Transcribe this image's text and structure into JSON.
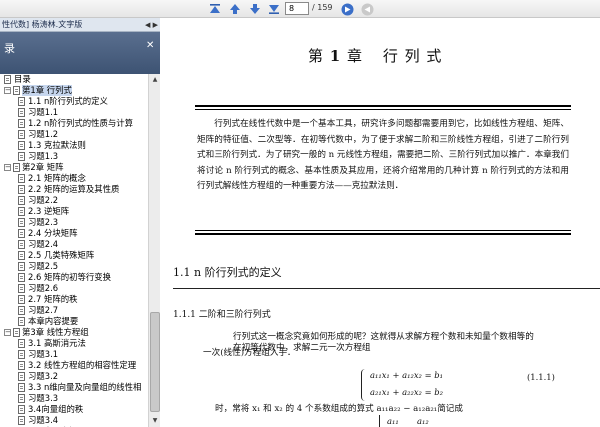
{
  "toolbar": {
    "icons": [
      "go-first-icon",
      "go-prev-icon",
      "go-next-icon",
      "go-last-icon",
      "go-forward-icon",
      "go-back-icon"
    ],
    "page_number": "8",
    "page_total": "/ 159"
  },
  "sidebar": {
    "doc_tab_label": "性代数] 杨涛林.文字版",
    "doc_tab_arrows": "◀ ▶",
    "bookmarks_title": "录",
    "close_glyph": "✕",
    "items": [
      {
        "label": "目录",
        "level": 0,
        "expand": ""
      },
      {
        "label": "第1章  行列式",
        "level": 0,
        "expand": "−",
        "selected": true
      },
      {
        "label": "1.1  n阶行列式的定义",
        "level": 1,
        "expand": ""
      },
      {
        "label": "习题1.1",
        "level": 1,
        "expand": ""
      },
      {
        "label": "1.2  n阶行列式的性质与计算",
        "level": 1,
        "expand": ""
      },
      {
        "label": "习题1.2",
        "level": 1,
        "expand": ""
      },
      {
        "label": "1.3  克拉默法则",
        "level": 1,
        "expand": ""
      },
      {
        "label": "习题1.3",
        "level": 1,
        "expand": ""
      },
      {
        "label": "第2章  矩阵",
        "level": 0,
        "expand": "−"
      },
      {
        "label": "2.1  矩阵的概念",
        "level": 1,
        "expand": ""
      },
      {
        "label": "2.2  矩阵的运算及其性质",
        "level": 1,
        "expand": ""
      },
      {
        "label": "习题2.2",
        "level": 1,
        "expand": ""
      },
      {
        "label": "2.3  逆矩阵",
        "level": 1,
        "expand": ""
      },
      {
        "label": "习题2.3",
        "level": 1,
        "expand": ""
      },
      {
        "label": "2.4  分块矩阵",
        "level": 1,
        "expand": ""
      },
      {
        "label": "习题2.4",
        "level": 1,
        "expand": ""
      },
      {
        "label": "2.5  几类特殊矩阵",
        "level": 1,
        "expand": ""
      },
      {
        "label": "习题2.5",
        "level": 1,
        "expand": ""
      },
      {
        "label": "2.6  矩阵的初等行变换",
        "level": 1,
        "expand": ""
      },
      {
        "label": "习题2.6",
        "level": 1,
        "expand": ""
      },
      {
        "label": "2.7  矩阵的秩",
        "level": 1,
        "expand": ""
      },
      {
        "label": "习题2.7",
        "level": 1,
        "expand": ""
      },
      {
        "label": "本章内容提要",
        "level": 1,
        "expand": ""
      },
      {
        "label": "第3章  线性方程组",
        "level": 0,
        "expand": "−"
      },
      {
        "label": "3.1  高斯消元法",
        "level": 1,
        "expand": ""
      },
      {
        "label": "习题3.1",
        "level": 1,
        "expand": ""
      },
      {
        "label": "3.2  线性方程组的相容性定理",
        "level": 1,
        "expand": ""
      },
      {
        "label": "习题3.2",
        "level": 1,
        "expand": ""
      },
      {
        "label": "3.3  n维向量及向量组的线性相",
        "level": 1,
        "expand": ""
      },
      {
        "label": "习题3.3",
        "level": 1,
        "expand": ""
      },
      {
        "label": "3.4向量组的秩",
        "level": 1,
        "expand": ""
      },
      {
        "label": "习题3.4",
        "level": 1,
        "expand": ""
      },
      {
        "label": "3.5  向量空间",
        "level": 1,
        "expand": ""
      },
      {
        "label": "习题3.5",
        "level": 1,
        "expand": ""
      }
    ]
  },
  "document": {
    "chapter_prefix": "第",
    "chapter_num": "1",
    "chapter_suffix": "章",
    "chapter_name": "行    列    式",
    "intro": "行列式在线性代数中是一个基本工具，研究许多问题都需要用到它，比如线性方程组、矩阵、矩阵的特征值、二次型等．在初等代数中，为了便于求解二阶和三阶线性方程组，引进了二阶行列式和三阶行列式．为了研究一般的 n 元线性方程组，需要把二阶、三阶行列式加以推广．本章我们将讨论 n 阶行列式的概念、基本性质及其应用，还将介绍常用的几种计算 n 阶行列式的方法和用行列式解线性方程组的一种重要方法——克拉默法则．",
    "section_title": "1.1    n 阶行列式的定义",
    "subsection_title": "1.1.1    二阶和三阶行列式",
    "para1_line1": "行列式这一概念究竟如何形成的呢？这就得从求解方程个数和未知量个数相等的",
    "para1_line2": "一次(线性)方程组入手．",
    "para2": "在初等代数中，求解二元一次方程组",
    "eq_line1": "a₁₁x₁ + a₁₂x₂ = b₁",
    "eq_line2": "a₂₁x₁ + a₂₂x₂ = b₂",
    "eq_number": "(1.1.1)",
    "para3": "时，常将 x₁ 和 x₂ 的 4 个系数组成的算式 a₁₁a₂₂ − a₁₂a₂₁简记成",
    "det_a11": "a₁₁",
    "det_a12": "a₁₂"
  }
}
